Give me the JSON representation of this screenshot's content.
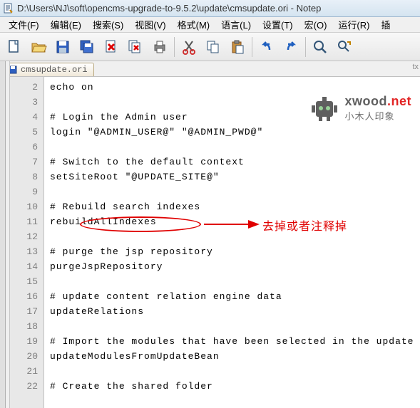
{
  "title": "D:\\Users\\NJ\\soft\\opencms-upgrade-to-9.5.2\\update\\cmsupdate.ori - Notep",
  "menu": {
    "file": "文件(F)",
    "edit": "编辑(E)",
    "search": "搜索(S)",
    "view": "视图(V)",
    "format": "格式(M)",
    "language": "语言(L)",
    "settings": "设置(T)",
    "macro": "宏(O)",
    "run": "运行(R)",
    "plugins": "插"
  },
  "tab": {
    "label": "cmsupdate.ori",
    "suffix_indicator": "tx"
  },
  "code_lines": [
    {
      "n": 2,
      "t": "echo on"
    },
    {
      "n": 3,
      "t": ""
    },
    {
      "n": 4,
      "t": "# Login the Admin user"
    },
    {
      "n": 5,
      "t": "login \"@ADMIN_USER@\" \"@ADMIN_PWD@\""
    },
    {
      "n": 6,
      "t": ""
    },
    {
      "n": 7,
      "t": "# Switch to the default context"
    },
    {
      "n": 8,
      "t": "setSiteRoot \"@UPDATE_SITE@\""
    },
    {
      "n": 9,
      "t": ""
    },
    {
      "n": 10,
      "t": "# Rebuild search indexes"
    },
    {
      "n": 11,
      "t": "rebuildAllIndexes"
    },
    {
      "n": 12,
      "t": ""
    },
    {
      "n": 13,
      "t": "# purge the jsp repository"
    },
    {
      "n": 14,
      "t": "purgeJspRepository"
    },
    {
      "n": 15,
      "t": ""
    },
    {
      "n": 16,
      "t": "# update content relation engine data"
    },
    {
      "n": 17,
      "t": "updateRelations"
    },
    {
      "n": 18,
      "t": ""
    },
    {
      "n": 19,
      "t": "# Import the modules that have been selected in the update"
    },
    {
      "n": 20,
      "t": "updateModulesFromUpdateBean"
    },
    {
      "n": 21,
      "t": ""
    },
    {
      "n": 22,
      "t": "# Create the shared folder"
    }
  ],
  "watermark": {
    "brand": "xwood",
    "tld": ".net",
    "cn": "小木人印象"
  },
  "annotation": {
    "text": "去掉或者注释掉"
  },
  "toolbar_icons": [
    "new-file-icon",
    "open-icon",
    "save-icon",
    "save-all-icon",
    "close-icon",
    "close-all-icon",
    "print-icon",
    "cut-icon",
    "copy-icon",
    "paste-icon",
    "undo-icon",
    "redo-icon",
    "find-icon",
    "replace-icon"
  ]
}
